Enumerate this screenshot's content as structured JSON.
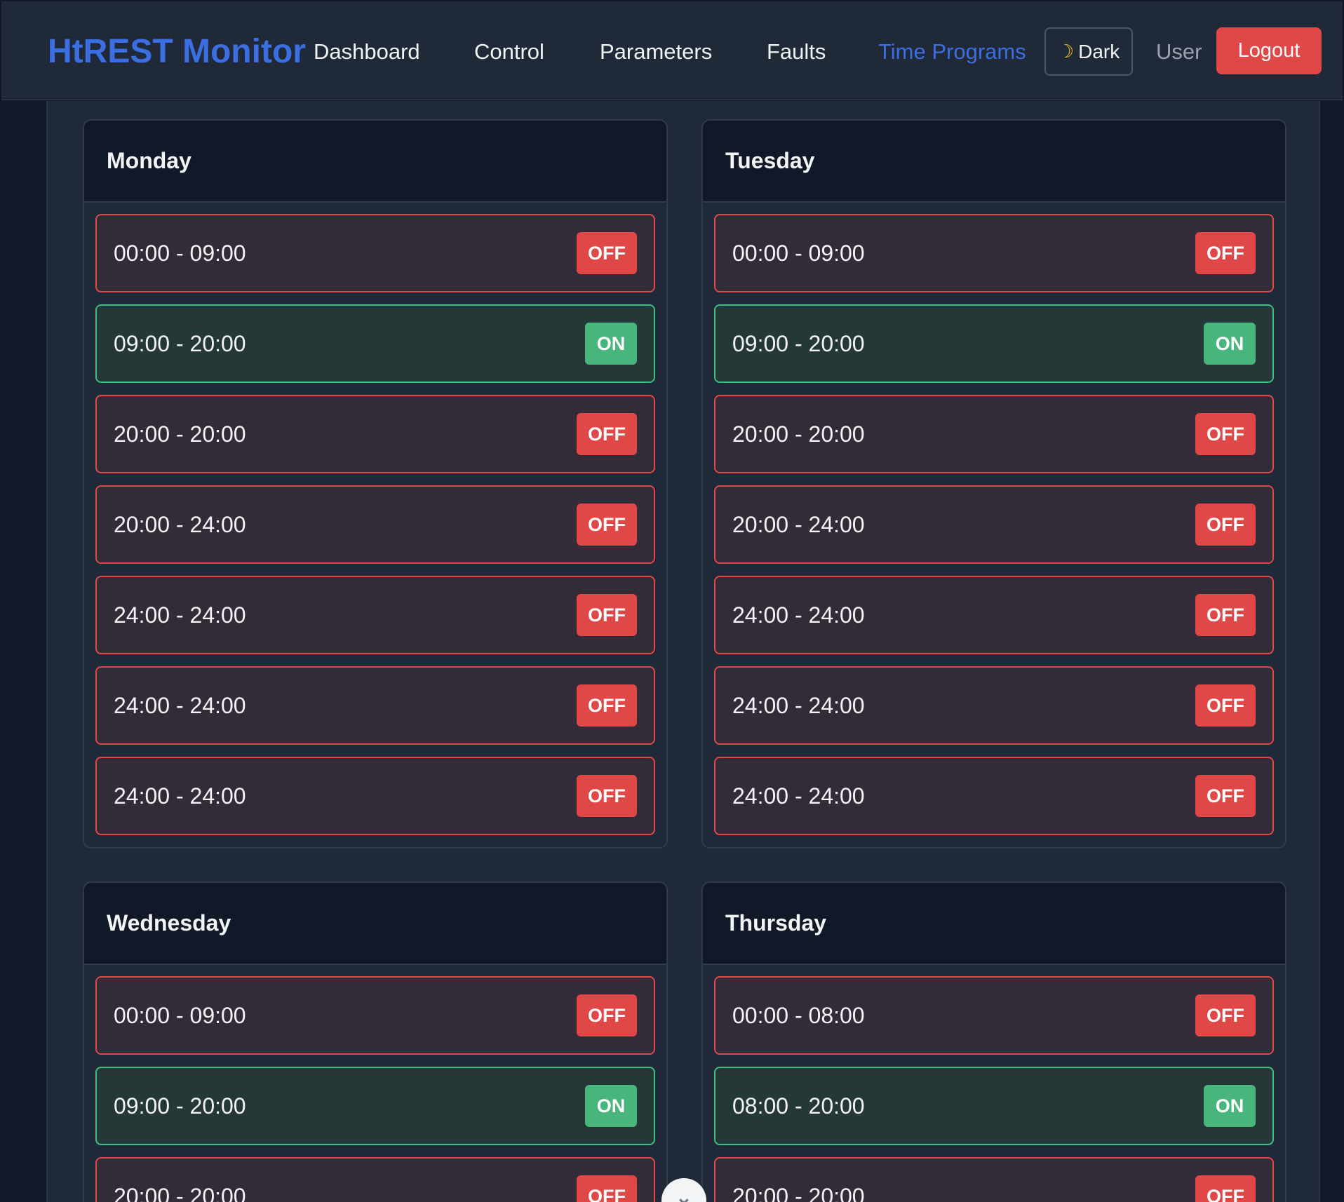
{
  "header": {
    "brand": "HtREST Monitor",
    "nav": [
      {
        "label": "Dashboard",
        "active": false
      },
      {
        "label": "Control",
        "active": false
      },
      {
        "label": "Parameters",
        "active": false
      },
      {
        "label": "Faults",
        "active": false
      },
      {
        "label": "Time Programs",
        "active": true
      }
    ],
    "theme_label": "Dark",
    "theme_icon": "moon-icon",
    "user_label": "User",
    "logout_label": "Logout"
  },
  "colors": {
    "accent": "#3b6ee0",
    "on": "#48b57c",
    "off": "#e04848",
    "background": "#111827",
    "panel": "#1f2937"
  },
  "days": [
    {
      "name": "Monday",
      "slots": [
        {
          "range": "00:00 - 09:00",
          "state": "OFF"
        },
        {
          "range": "09:00 - 20:00",
          "state": "ON"
        },
        {
          "range": "20:00 - 20:00",
          "state": "OFF"
        },
        {
          "range": "20:00 - 24:00",
          "state": "OFF"
        },
        {
          "range": "24:00 - 24:00",
          "state": "OFF"
        },
        {
          "range": "24:00 - 24:00",
          "state": "OFF"
        },
        {
          "range": "24:00 - 24:00",
          "state": "OFF"
        }
      ]
    },
    {
      "name": "Tuesday",
      "slots": [
        {
          "range": "00:00 - 09:00",
          "state": "OFF"
        },
        {
          "range": "09:00 - 20:00",
          "state": "ON"
        },
        {
          "range": "20:00 - 20:00",
          "state": "OFF"
        },
        {
          "range": "20:00 - 24:00",
          "state": "OFF"
        },
        {
          "range": "24:00 - 24:00",
          "state": "OFF"
        },
        {
          "range": "24:00 - 24:00",
          "state": "OFF"
        },
        {
          "range": "24:00 - 24:00",
          "state": "OFF"
        }
      ]
    },
    {
      "name": "Wednesday",
      "slots": [
        {
          "range": "00:00 - 09:00",
          "state": "OFF"
        },
        {
          "range": "09:00 - 20:00",
          "state": "ON"
        },
        {
          "range": "20:00 - 20:00",
          "state": "OFF"
        }
      ]
    },
    {
      "name": "Thursday",
      "slots": [
        {
          "range": "00:00 - 08:00",
          "state": "OFF"
        },
        {
          "range": "08:00 - 20:00",
          "state": "ON"
        },
        {
          "range": "20:00 - 20:00",
          "state": "OFF"
        }
      ]
    }
  ],
  "scroll_button": {
    "icon": "chevron-down-icon",
    "glyph": "⌄"
  }
}
